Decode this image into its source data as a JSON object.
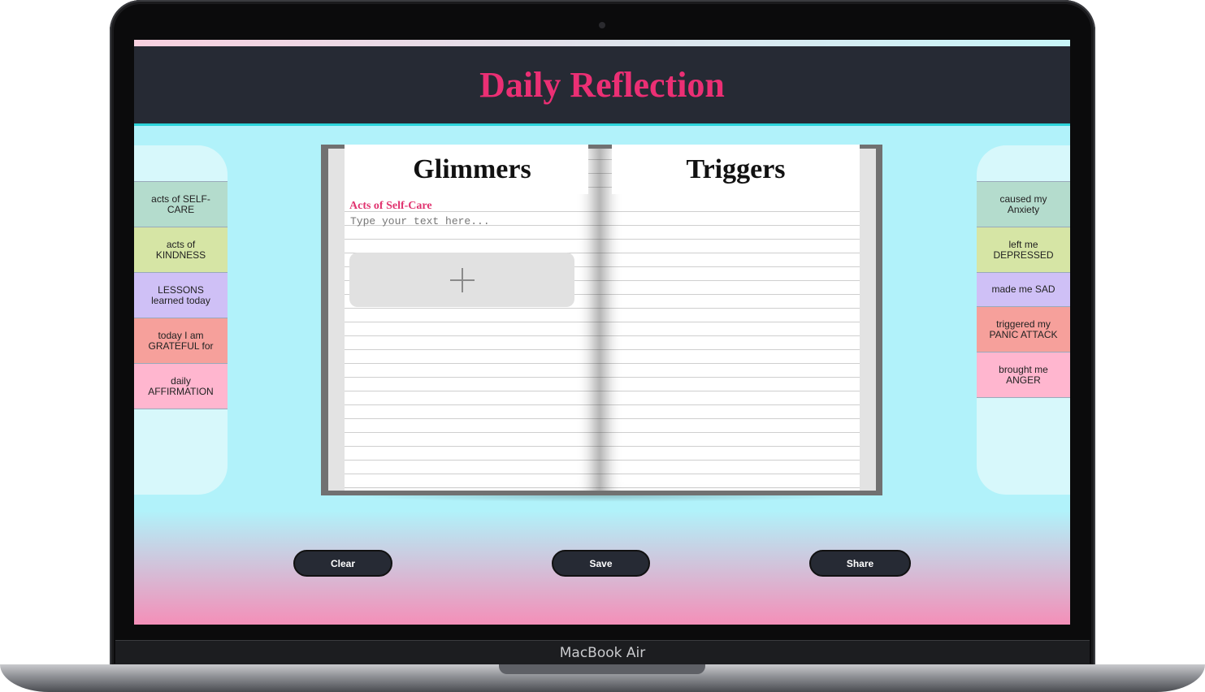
{
  "device": {
    "label": "MacBook Air"
  },
  "app": {
    "title": "Daily Reflection"
  },
  "left_sidebar": {
    "tabs": [
      {
        "line1": "acts of SELF-",
        "line2": "CARE",
        "color": "#b4dccd"
      },
      {
        "line1": "acts of",
        "line2": "KINDNESS",
        "color": "#d6e5a5"
      },
      {
        "line1": "LESSONS",
        "line2": "learned today",
        "color": "#cfc0f6"
      },
      {
        "line1": "today I am",
        "line2": "GRATEFUL for",
        "color": "#f6a09b"
      },
      {
        "line1": "daily",
        "line2": "AFFIRMATION",
        "color": "#ffb6cf"
      }
    ]
  },
  "right_sidebar": {
    "tabs": [
      {
        "line1": "caused my",
        "line2": "Anxiety",
        "color": "#b4dccd"
      },
      {
        "line1": "left me",
        "line2": "DEPRESSED",
        "color": "#d6e5a5"
      },
      {
        "line1": "made me SAD",
        "line2": "",
        "color": "#cfc0f6"
      },
      {
        "line1": "triggered my",
        "line2": "PANIC ATTACK",
        "color": "#f6a09b"
      },
      {
        "line1": "brought me",
        "line2": "ANGER",
        "color": "#ffb6cf"
      }
    ]
  },
  "notebook": {
    "left_heading": "Glimmers",
    "right_heading": "Triggers",
    "section_label": "Acts of Self-Care",
    "input": {
      "value": "",
      "placeholder": "Type your text here..."
    },
    "add_icon": "plus-icon"
  },
  "actions": {
    "clear_label": "Clear",
    "save_label": "Save",
    "share_label": "Share"
  },
  "colors": {
    "header_bg": "#262a34",
    "title": "#eb2f74",
    "screen_bg": "#b1f2fa",
    "screen_bottom": "#f48fb8",
    "accent_label": "#e0336f"
  }
}
